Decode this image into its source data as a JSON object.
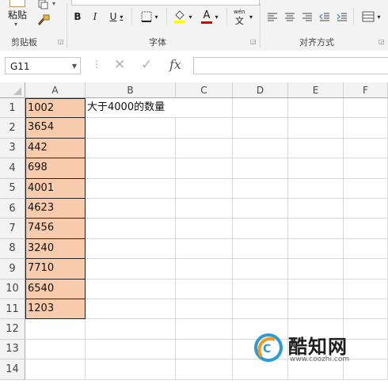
{
  "ribbon": {
    "paste_label": "粘贴",
    "clipboard_label": "剪贴板",
    "font_label": "字体",
    "align_label": "对齐方式",
    "bold": "B",
    "italic": "I",
    "underline": "U",
    "font_color_glyph": "A",
    "phonetic_glyph": "wén",
    "phonetic_sub": "文"
  },
  "formula_bar": {
    "name_box": "G11",
    "cancel": "✕",
    "enter": "✓",
    "fx": "fx",
    "content": ""
  },
  "sheet": {
    "columns": [
      "A",
      "B",
      "C",
      "D",
      "E",
      "F"
    ],
    "rows": [
      "1",
      "2",
      "3",
      "4",
      "5",
      "6",
      "7",
      "8",
      "9",
      "10",
      "11",
      "12",
      "13",
      "14"
    ],
    "column_a": [
      "1002",
      "3654",
      "442",
      "698",
      "4001",
      "4623",
      "7456",
      "3240",
      "7710",
      "6540",
      "1203"
    ],
    "b1": "大于4000的数量",
    "fill_color": "#f8cbad",
    "selected_cell": "G11"
  },
  "watermark": {
    "brand": "酷知网",
    "url": "www.coozhi.com"
  }
}
